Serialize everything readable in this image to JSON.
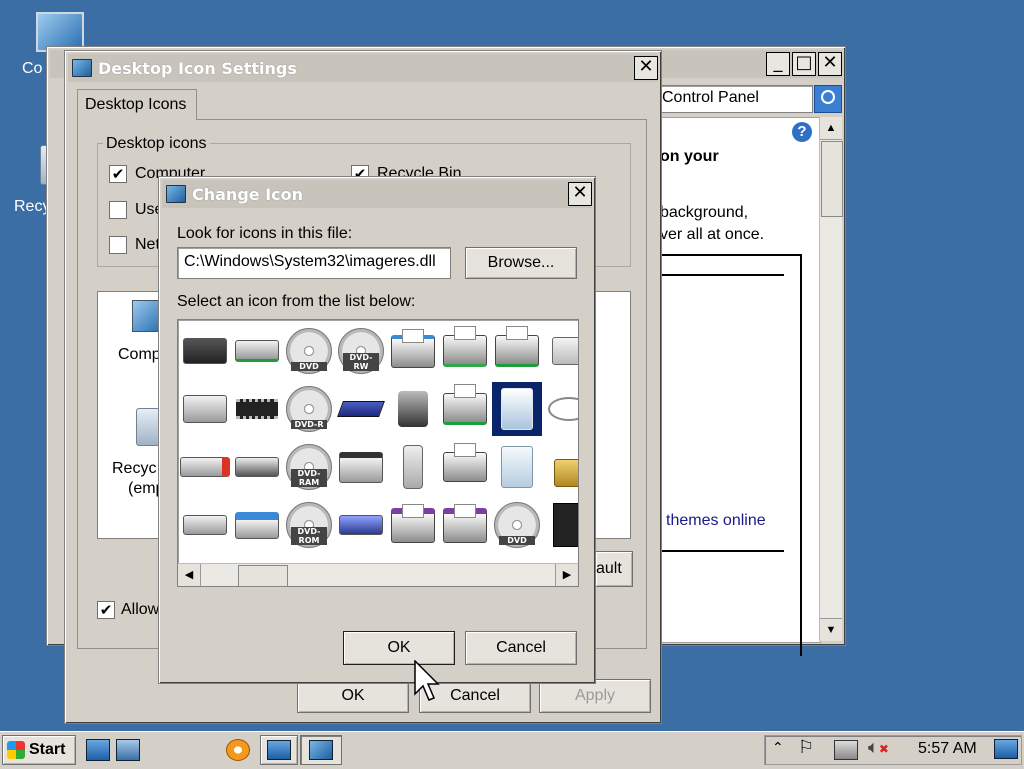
{
  "desktop": {
    "icon_computer_label": "Co",
    "icon_recycle_label": "Recy"
  },
  "control_panel": {
    "address_text": "Control Panel",
    "heading_fragment": "on your",
    "text_line1": "background,",
    "text_line2": "ver all at once.",
    "link_themes": "themes online",
    "help_glyph": "?"
  },
  "desktop_icon_settings": {
    "title": "Desktop Icon Settings",
    "tab_label": "Desktop Icons",
    "group_label": "Desktop icons",
    "checkboxes": [
      {
        "label": "Computer",
        "checked": true
      },
      {
        "label": "Use",
        "checked": false
      },
      {
        "label": "Net",
        "checked": false
      },
      {
        "label": "Recycle Bin",
        "checked": true
      }
    ],
    "preview_labels": [
      "Comp",
      "Recyc",
      "(emp"
    ],
    "restore_button_fragment": "ault",
    "allow_label": "Allow",
    "allow_checked": true,
    "ok_label": "OK",
    "cancel_label": "Cancel",
    "apply_label": "Apply"
  },
  "change_icon": {
    "title": "Change Icon",
    "look_label": "Look for icons in this file:",
    "file_path": "C:\\Windows\\System32\\imageres.dll",
    "browse_label": "Browse...",
    "select_label": "Select an icon from the list below:",
    "disc_labels": {
      "dvd": "DVD",
      "dvd_rw": "DVD-RW",
      "dvd_r": "DVD-R",
      "dvd_ram": "DVD-RAM",
      "dvd_rom": "DVD-ROM"
    },
    "ok_label": "OK",
    "cancel_label": "Cancel"
  },
  "taskbar": {
    "start_label": "Start",
    "clock": "5:57 AM"
  },
  "close_glyph": "✕",
  "minimize_glyph": "_",
  "maximize_glyph": "□"
}
